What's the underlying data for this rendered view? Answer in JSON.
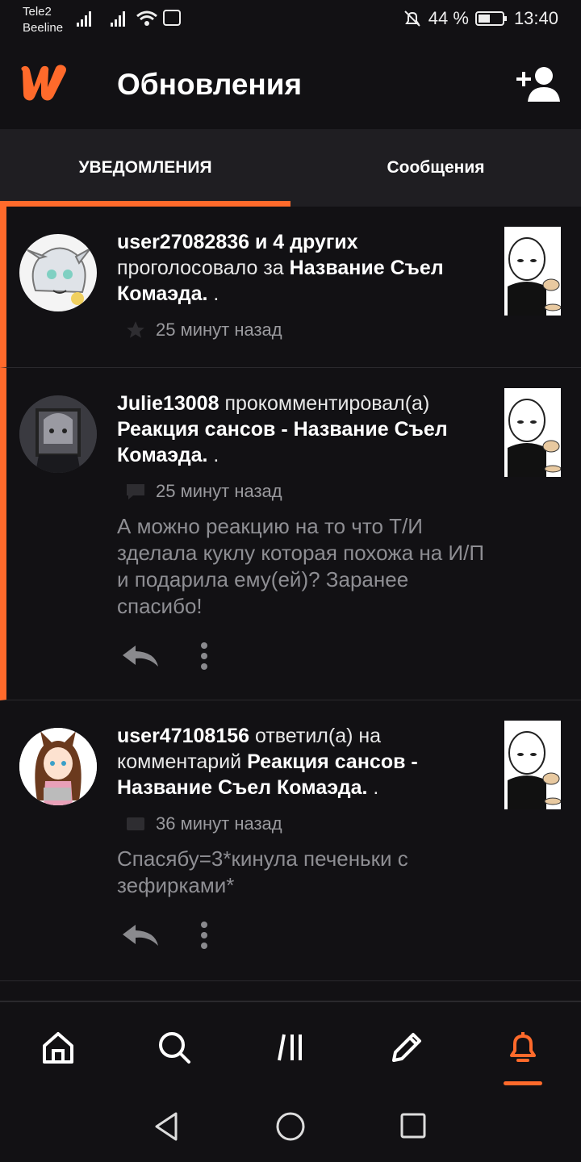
{
  "status_bar": {
    "carrier_1": "Tele2",
    "carrier_2": "Beeline",
    "battery": "44 %",
    "time": "13:40"
  },
  "header": {
    "title": "Обновления",
    "logo_icon": "wattpad-logo-icon",
    "add_friend_icon": "add-user-icon"
  },
  "tabs": {
    "notifications": "УВЕДОМЛЕНИЯ",
    "messages": "Сообщения"
  },
  "notifications": [
    {
      "user": "user27082836 и 4 других",
      "action": " проголосовало за ",
      "story": "Название Съел Комаэда.",
      "suffix": " .",
      "time": "25 минут назад",
      "type_icon": "star-icon"
    },
    {
      "user": "Julie13008",
      "action": " прокомментировал(а) ",
      "story": "Реакция сансов - Название Съел Комаэда.",
      "suffix": " .",
      "time": "25 минут назад",
      "type_icon": "comment-icon",
      "comment": "А можно реакцию на то что Т/И зделала куклу которая похожа на И/П и подарила ему(ей)? Заранее спасибо!"
    },
    {
      "user": "user47108156",
      "action": " ответил(а) на комментарий ",
      "story": "Реакция сансов - Название Съел Комаэда.",
      "suffix": " .",
      "time": "36 минут назад",
      "type_icon": "reply-bubble-icon",
      "comment": "Спасябу=3*кинула печеньки с зефирками*"
    }
  ],
  "colors": {
    "accent": "#ff6a2b",
    "background": "#121114",
    "tab_bar": "#1f1e22"
  }
}
